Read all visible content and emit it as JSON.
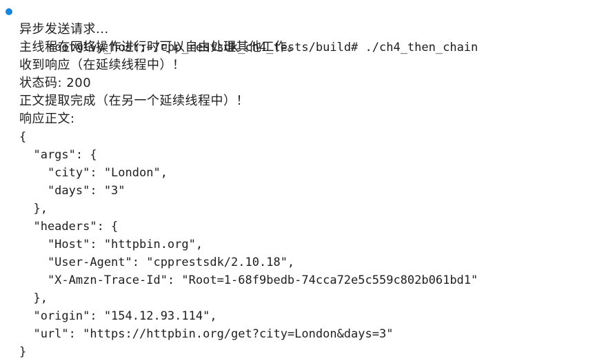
{
  "terminal": {
    "bullet_color": "#1a85d6",
    "command_line": "root@lvy_host:~/cpp_restsdk_ch4_tests/build# ./ch4_then_chain",
    "output": [
      "异步发送请求...",
      "主线程在网络操作进行时可以自由处理其他工作。",
      "收到响应（在延续线程中）！",
      "状态码: 200",
      "正文提取完成（在另一个延续线程中）！",
      "响应正文:",
      "{",
      "  \"args\": {",
      "    \"city\": \"London\",",
      "    \"days\": \"3\"",
      "  },",
      "  \"headers\": {",
      "    \"Host\": \"httpbin.org\",",
      "    \"User-Agent\": \"cpprestsdk/2.10.18\",",
      "    \"X-Amzn-Trace-Id\": \"Root=1-68f9bedb-74cca72e5c559c802b061bd1\"",
      "  },",
      "  \"origin\": \"154.12.93.114\",",
      "  \"url\": \"https://httpbin.org/get?city=London&days=3\"",
      "}"
    ]
  }
}
